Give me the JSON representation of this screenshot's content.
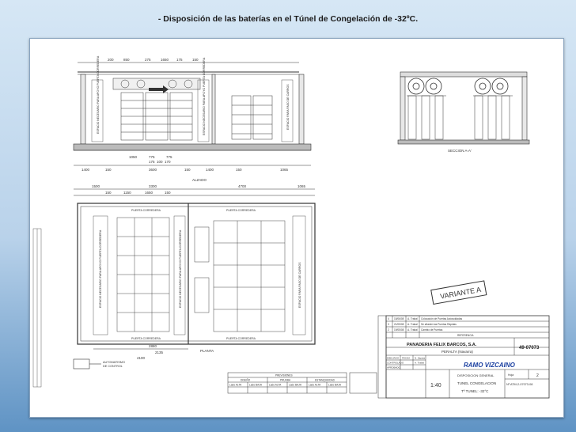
{
  "slide": {
    "title": "- Disposición de las baterías en el Túnel de Congelación de -32ºC."
  },
  "drawing": {
    "elevation_label": "ALZADO",
    "plan_label": "PLANTA",
    "section_label": "SECCION A-A'",
    "variant_label": "VARIANTE A",
    "control_label_1": "AUTOMATISMO",
    "control_label_2": "DE CONTROL",
    "elev_top_dims": [
      "200",
      "850",
      "275",
      "1650",
      "175",
      "150"
    ],
    "elev_bottom_dims": [
      "1400",
      "150",
      "3600",
      "150",
      "1400",
      "150",
      "1065"
    ],
    "elev_mid_dims": [
      "1050",
      "775",
      "775",
      "175",
      "100",
      "170"
    ],
    "plan_top_dims": [
      "1500",
      "3300",
      "4700",
      "1065"
    ],
    "plan_sub_dims": [
      "150",
      "1150",
      "1650",
      "150"
    ],
    "plan_bottom_dims": [
      "2880",
      "2135",
      "4100"
    ],
    "side_note_1": "ESPACIO NECESARIO PARA APOYO PUERTA CORREDERA",
    "side_note_2": "ESPACIO PARA PASO DE CARROS",
    "door_label": "PUERTA CORREDERA"
  },
  "title_block": {
    "client": "PANADERIA FELIX BARCOS, S.A.",
    "location": "PERALTA  (Navarra)",
    "drawing_number": "49-07073",
    "company_logo": "RAMO VIZCAINO",
    "scale": "1:40",
    "description_1": "DISPOSICION GENERAL",
    "description_2": "TUNEL CONGELACION",
    "description_3": "Tª TUNEL: -32°C",
    "file_ref": "Nº ATM-2-07073-08",
    "sheet_label": "Hoja",
    "sheet_number": "2",
    "revision_label": "REVIS. DEL PLANO",
    "revision_header": "REFERENCIA",
    "revisions": [
      {
        "n": "4",
        "date": "15/06/08",
        "by": "A. Trabal",
        "text": "Colocación de Puertas Autosoldadas"
      },
      {
        "n": "3",
        "date": "21/05/08",
        "by": "A. Trabal",
        "text": "Se añaden las Puertas Rápidas"
      },
      {
        "n": "2",
        "date": "19/05/08",
        "by": "A. Trabal",
        "text": "Cambio de Puertas"
      }
    ],
    "drawn_label": "DIBUJADO",
    "checked_label": "CONTROLADO",
    "approved_label": "APROBADO",
    "date_header": "FECHA",
    "drawn_by": "N. Zapata",
    "checked_by": "A. Trabal"
  },
  "legend_table": {
    "header": "PREVISIONES",
    "columns": [
      "DISEÑO",
      "PRUEBA",
      "ESTANQUEIDAD"
    ],
    "subcolumns": [
      "Lado ALTA",
      "Lado BAJA"
    ]
  }
}
